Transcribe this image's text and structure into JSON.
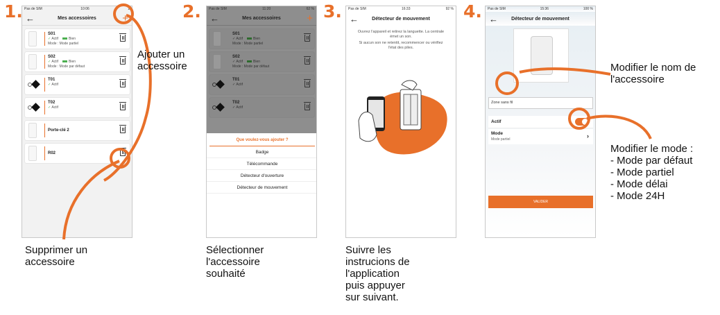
{
  "steps": [
    "1.",
    "2.",
    "3.",
    "4."
  ],
  "phone1": {
    "status": {
      "carrier": "Pas de SIM",
      "time": "10:06",
      "battery": "1"
    },
    "title": "Mes accessoires",
    "items": [
      {
        "name": "S01",
        "status": "Actif",
        "battery": "Bien",
        "mode": "Mode : Mode partiel"
      },
      {
        "name": "S02",
        "status": "Actif",
        "battery": "Bien",
        "mode": "Mode : Mode par défaut"
      },
      {
        "name": "T01",
        "status": "Actif"
      },
      {
        "name": "T02",
        "status": "Actif"
      },
      {
        "name": "Porte-clé 2"
      },
      {
        "name": "R02"
      }
    ]
  },
  "phone2": {
    "status": {
      "carrier": "Pas de SIM",
      "time": "11:20",
      "battery": "62 %"
    },
    "title": "Mes accessoires",
    "items": [
      {
        "name": "S01",
        "status": "Actif",
        "battery": "Bien",
        "mode": "Mode : Mode partiel"
      },
      {
        "name": "S02",
        "status": "Actif",
        "battery": "Bien",
        "mode": "Mode : Mode par défaut"
      },
      {
        "name": "T01",
        "status": "Actif"
      },
      {
        "name": "T02",
        "status": "Actif"
      }
    ],
    "sheet_title": "Que voulez-vous ajouter ?",
    "options": [
      "Badge",
      "Télécommande",
      "Détecteur d'ouverture",
      "Détecteur de mouvement"
    ]
  },
  "phone3": {
    "status": {
      "carrier": "Pas de SIM",
      "time": "16:33",
      "battery": "92 %"
    },
    "title": "Détecteur de mouvement",
    "instruction1": "Ouvrez l'appareil et retirez la languette. La centrale émet un son.",
    "instruction2": "Si aucun son ne retentit, recommencer ou vérifiez l'état des piles."
  },
  "phone4": {
    "status": {
      "carrier": "Pas de SIM",
      "time": "15:36",
      "battery": "100 %"
    },
    "title": "Détecteur de mouvement",
    "name_field": "Zone sans fil",
    "actif_label": "Actif",
    "mode_label": "Mode",
    "mode_value": "Mode partiel",
    "validate": "VALIDER"
  },
  "annotations": {
    "add": "Ajouter un accessoire",
    "delete": "Supprimer un accessoire",
    "select": "Sélectionner l'accessoire souhaité",
    "follow": "Suivre les instrucions de l'application puis appuyer sur suivant.",
    "rename": "Modifier le nom de l'accessoire",
    "mode_title": "Modifier le mode :",
    "modes": [
      "- Mode par défaut",
      "- Mode partiel",
      "- Mode délai",
      "- Mode 24H"
    ]
  },
  "colors": {
    "accent": "#e8702a",
    "ok": "#4caf50"
  }
}
